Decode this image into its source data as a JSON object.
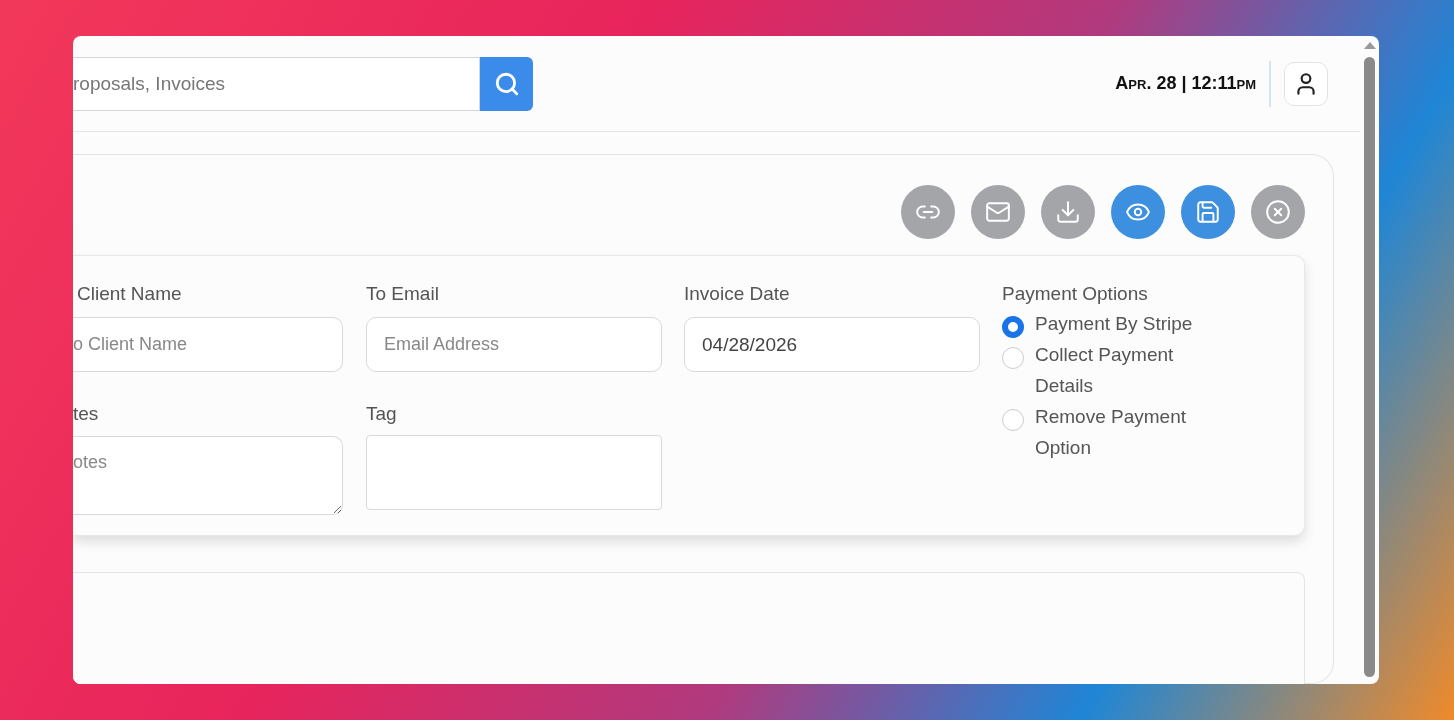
{
  "header": {
    "search": {
      "placeholder": "roposals, Invoices"
    },
    "datetime": "Apr. 28 | 12:11pm"
  },
  "actions": [
    {
      "kind": "link",
      "active": false
    },
    {
      "kind": "email",
      "active": false
    },
    {
      "kind": "download",
      "active": false
    },
    {
      "kind": "preview",
      "active": true
    },
    {
      "kind": "save",
      "active": true
    },
    {
      "kind": "close",
      "active": false
    }
  ],
  "form": {
    "client_name": {
      "label": "Client Name",
      "placeholder": "o Client Name"
    },
    "to_email": {
      "label": "To Email",
      "placeholder": "Email Address"
    },
    "invoice_date": {
      "label": "Invoice Date",
      "value": "04/28/2026"
    },
    "notes": {
      "label": "tes",
      "placeholder": "otes"
    },
    "tag": {
      "label": "Tag"
    },
    "payment_options": {
      "label": "Payment Options",
      "options": [
        {
          "label": "Payment By Stripe",
          "selected": true
        },
        {
          "label": "Collect Payment Details",
          "selected": false
        },
        {
          "label": "Remove Payment Option",
          "selected": false
        }
      ]
    }
  }
}
